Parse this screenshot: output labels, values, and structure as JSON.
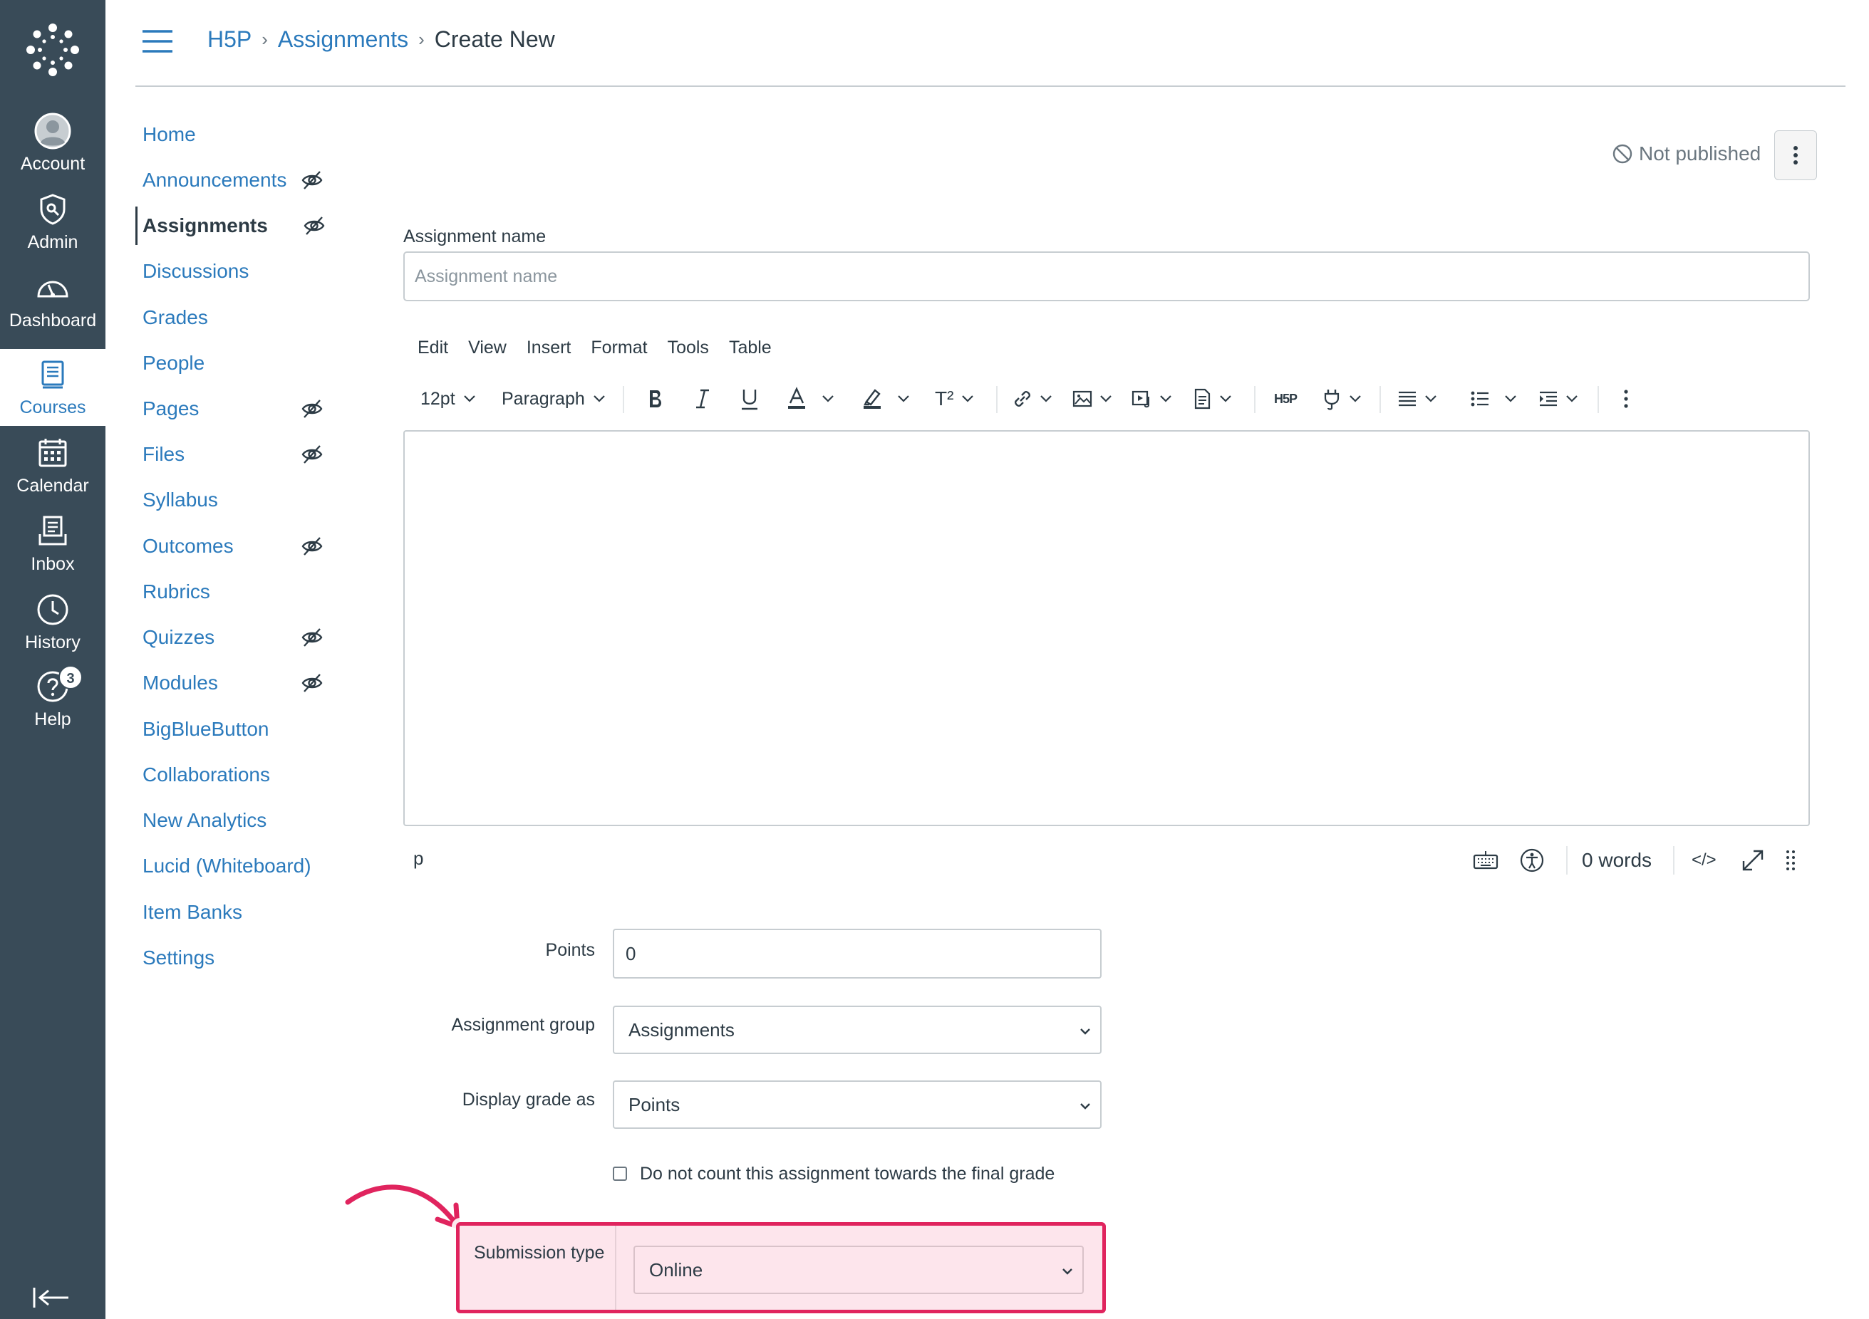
{
  "global_nav": {
    "items": [
      {
        "label": "Account",
        "icon": "user-avatar-icon"
      },
      {
        "label": "Admin",
        "icon": "shield-icon"
      },
      {
        "label": "Dashboard",
        "icon": "dashboard-gauge-icon"
      },
      {
        "label": "Courses",
        "icon": "book-icon",
        "active": true
      },
      {
        "label": "Calendar",
        "icon": "calendar-icon"
      },
      {
        "label": "Inbox",
        "icon": "inbox-icon"
      },
      {
        "label": "History",
        "icon": "clock-icon"
      },
      {
        "label": "Help",
        "icon": "help-circle-icon",
        "badge": "3"
      }
    ]
  },
  "breadcrumb": {
    "items": [
      "H5P",
      "Assignments"
    ],
    "current": "Create New"
  },
  "course_nav": {
    "items": [
      {
        "label": "Home",
        "hidden": false
      },
      {
        "label": "Announcements",
        "hidden": true
      },
      {
        "label": "Assignments",
        "hidden": true,
        "active": true
      },
      {
        "label": "Discussions",
        "hidden": false
      },
      {
        "label": "Grades",
        "hidden": false
      },
      {
        "label": "People",
        "hidden": false
      },
      {
        "label": "Pages",
        "hidden": true
      },
      {
        "label": "Files",
        "hidden": true
      },
      {
        "label": "Syllabus",
        "hidden": false
      },
      {
        "label": "Outcomes",
        "hidden": true
      },
      {
        "label": "Rubrics",
        "hidden": false
      },
      {
        "label": "Quizzes",
        "hidden": true
      },
      {
        "label": "Modules",
        "hidden": true
      },
      {
        "label": "BigBlueButton",
        "hidden": false
      },
      {
        "label": "Collaborations",
        "hidden": false
      },
      {
        "label": "New Analytics",
        "hidden": false
      },
      {
        "label": "Lucid (Whiteboard)",
        "hidden": false
      },
      {
        "label": "Item Banks",
        "hidden": false
      },
      {
        "label": "Settings",
        "hidden": false
      }
    ]
  },
  "publish": {
    "status": "Not published"
  },
  "assignment_name": {
    "label": "Assignment name",
    "placeholder": "Assignment name",
    "value": ""
  },
  "rce": {
    "menubar": [
      "Edit",
      "View",
      "Insert",
      "Format",
      "Tools",
      "Table"
    ],
    "font_size": "12pt",
    "block_format": "Paragraph",
    "h5p_label": "H5P",
    "superscript_label": "T²",
    "status_path": "p",
    "word_count": "0 words",
    "html_toggle": "</>"
  },
  "form": {
    "points": {
      "label": "Points",
      "value": "0"
    },
    "assignment_group": {
      "label": "Assignment group",
      "value": "Assignments"
    },
    "display_grade": {
      "label": "Display grade as",
      "value": "Points"
    },
    "no_count": {
      "label": "Do not count this assignment towards the final grade",
      "checked": false
    },
    "submission_type": {
      "label": "Submission type",
      "value": "Online"
    }
  },
  "colors": {
    "nav_bg": "#394b58",
    "link": "#2b7abc",
    "highlight": "#e0245e",
    "highlight_fill": "#fde5ec"
  }
}
